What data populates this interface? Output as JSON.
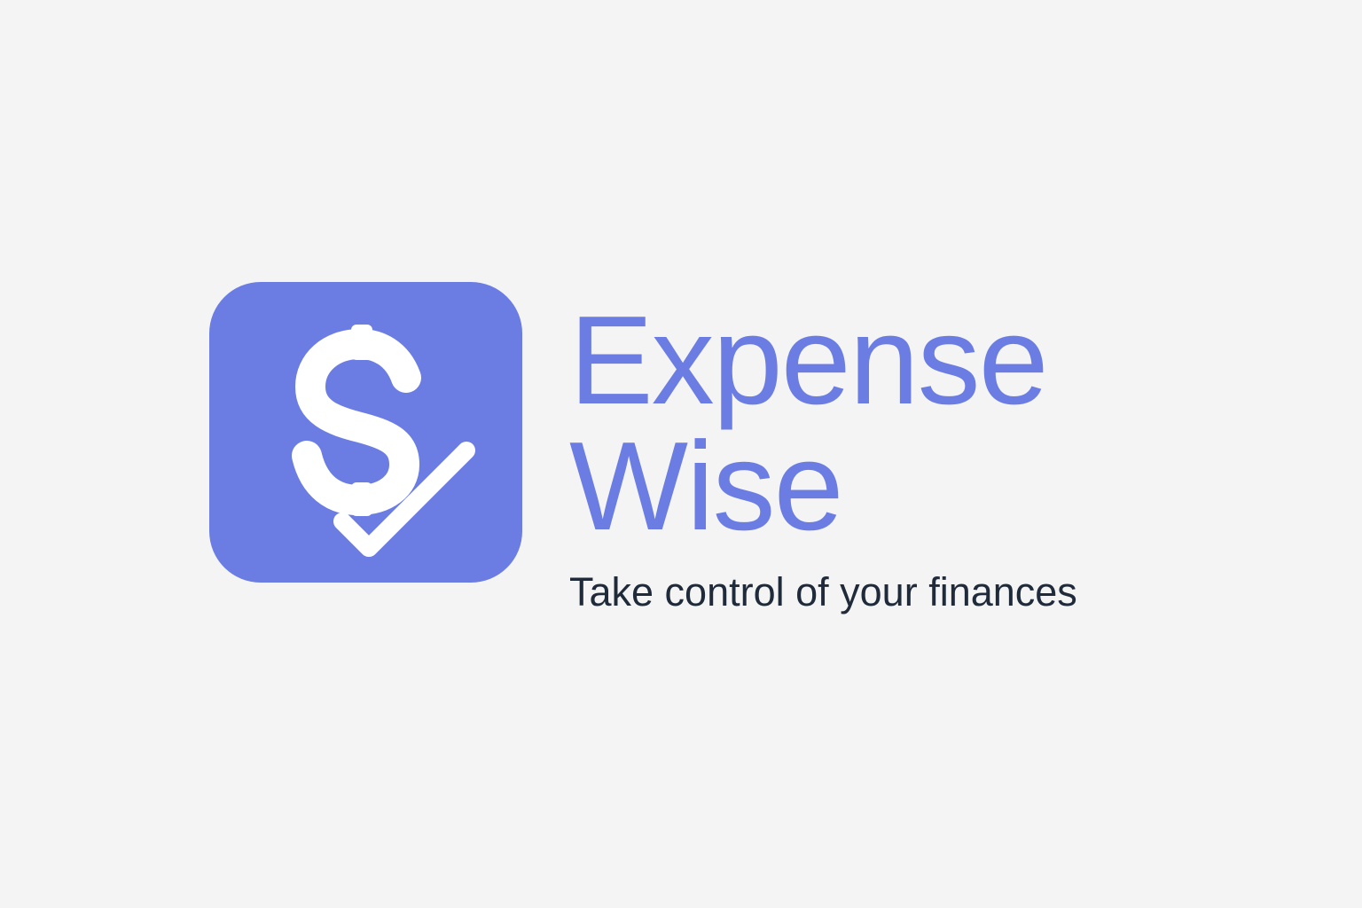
{
  "brand": {
    "name_line1": "Expense",
    "name_line2": "Wise",
    "tagline": "Take control of your finances",
    "icon": "dollar-check-icon",
    "colors": {
      "accent": "#6b7de3",
      "background": "#f4f4f4",
      "tagline_text": "#1f2a3a",
      "icon_glyph": "#ffffff"
    }
  }
}
